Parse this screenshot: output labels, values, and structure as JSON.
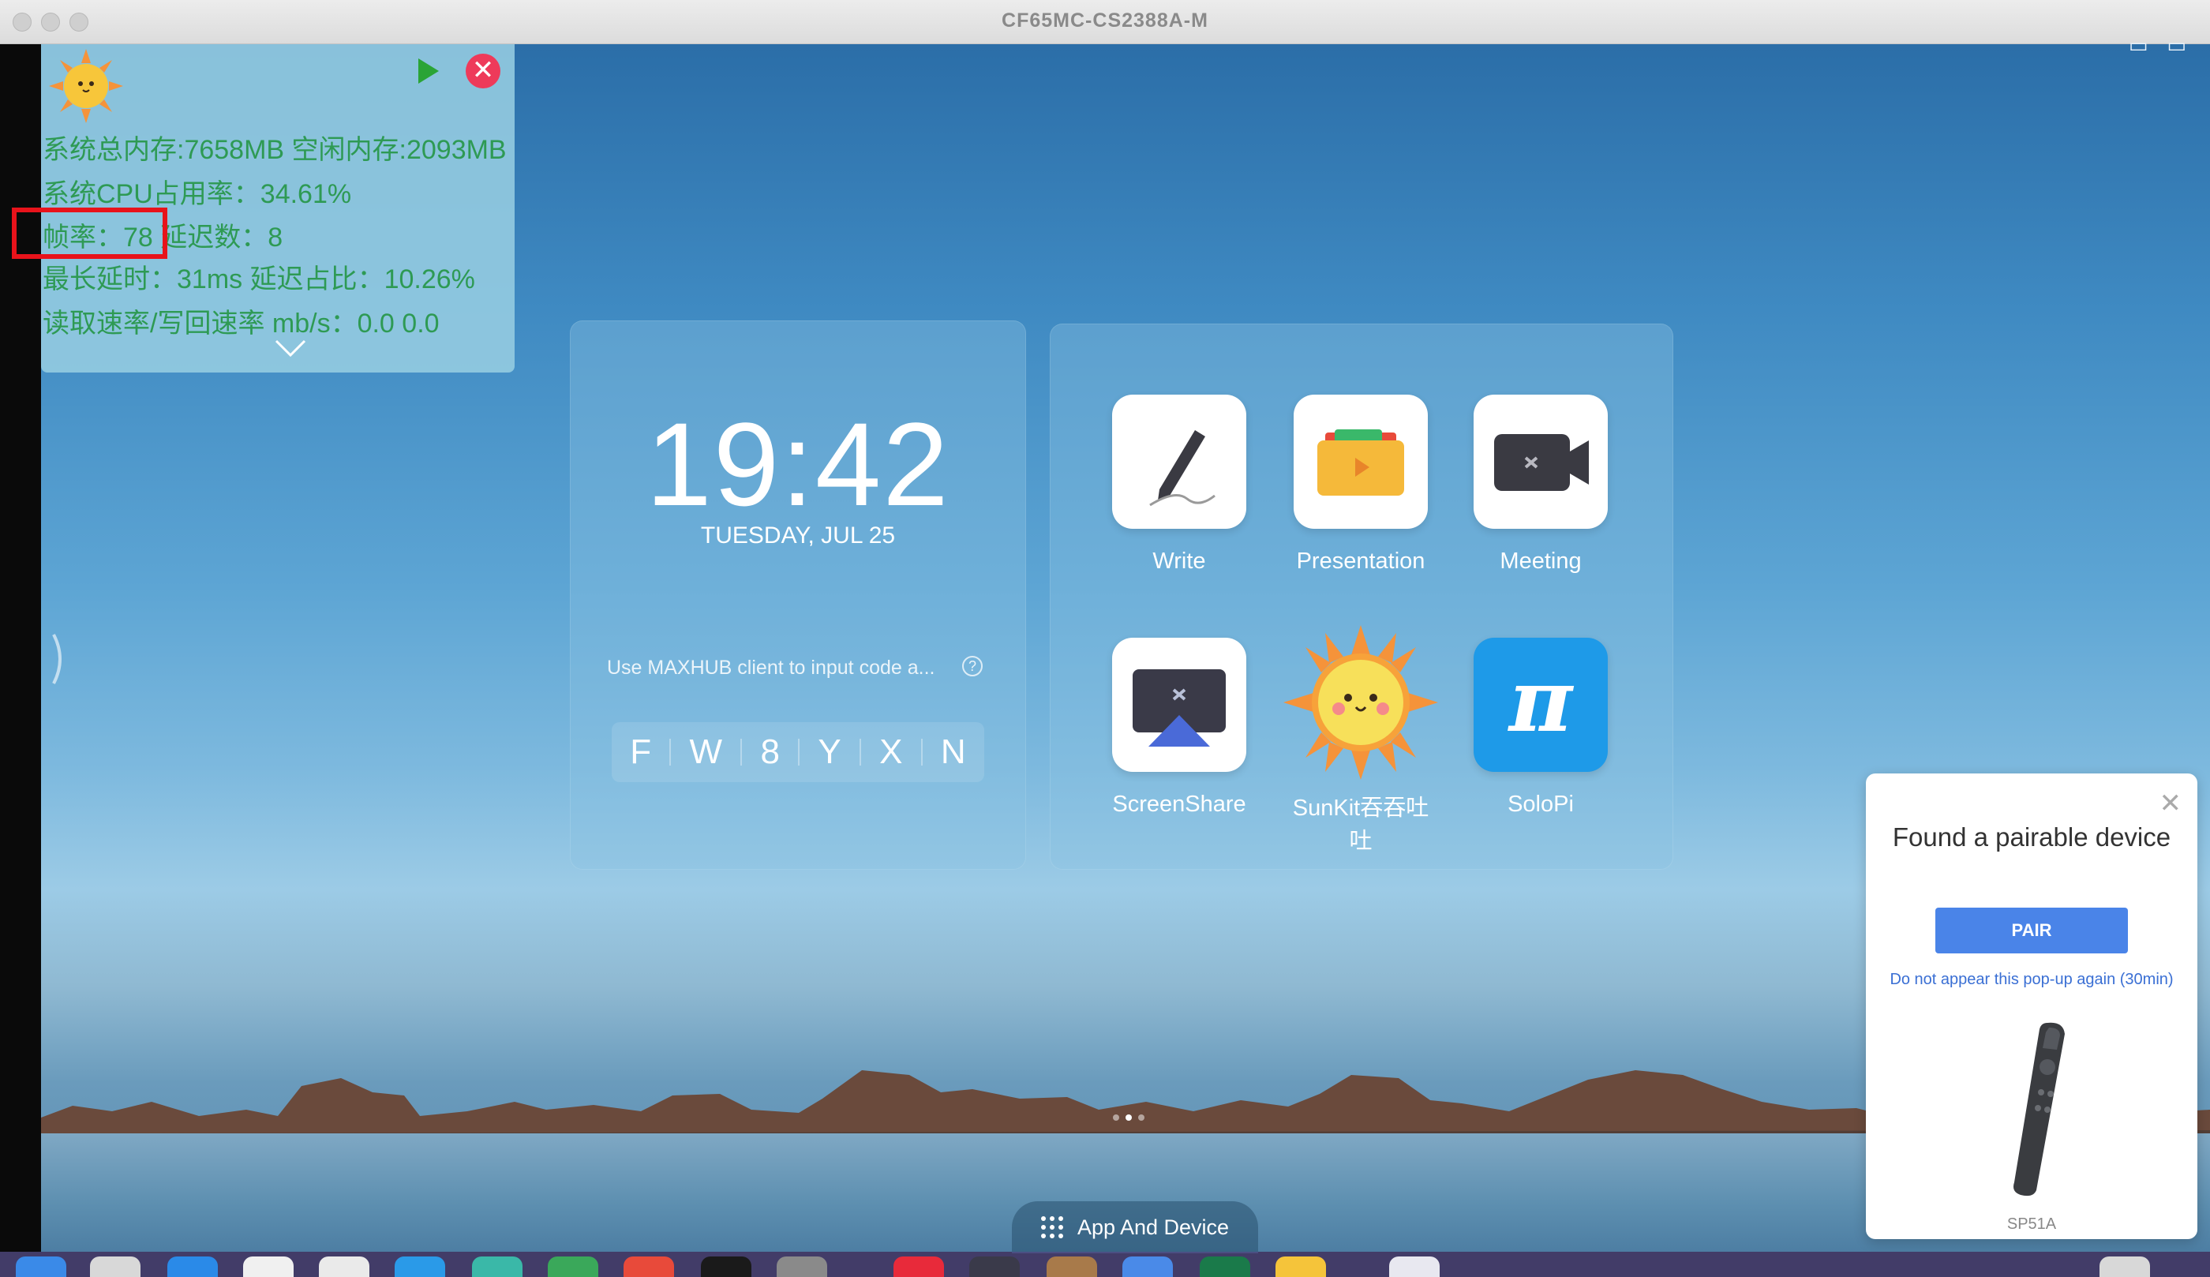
{
  "window": {
    "title": "CF65MC-CS2388A-M"
  },
  "perf_overlay": {
    "lines": [
      "系统总内存:7658MB 空闲内存:2093MB",
      "系统CPU占用率：34.61%",
      "帧率：78 延迟数：8",
      "最长延时：31ms 延迟占比：10.26%",
      "读取速率/写回速率 mb/s：0.0  0.0"
    ],
    "close_glyph": "✕"
  },
  "clock": {
    "time": "19:42",
    "date": "TUESDAY, JUL 25",
    "hint": "Use MAXHUB client to input code a...",
    "help_glyph": "?",
    "code": [
      "F",
      "W",
      "8",
      "Y",
      "X",
      "N"
    ]
  },
  "apps": [
    {
      "label": "Write"
    },
    {
      "label": "Presentation"
    },
    {
      "label": "Meeting"
    },
    {
      "label": "ScreenShare"
    },
    {
      "label": "SunKit吞吞吐吐"
    },
    {
      "label": "SoloPi"
    }
  ],
  "popup": {
    "title": "Found a pairable device",
    "button": "PAIR",
    "link": "Do not appear this pop-up again (30min)",
    "model": "SP51A",
    "close_glyph": "✕"
  },
  "bottom": {
    "app_and_device": "App And Device"
  },
  "colors": {
    "accent": "#4a84e8",
    "perf_text": "#2e9a54",
    "highlight": "#e8131b"
  }
}
